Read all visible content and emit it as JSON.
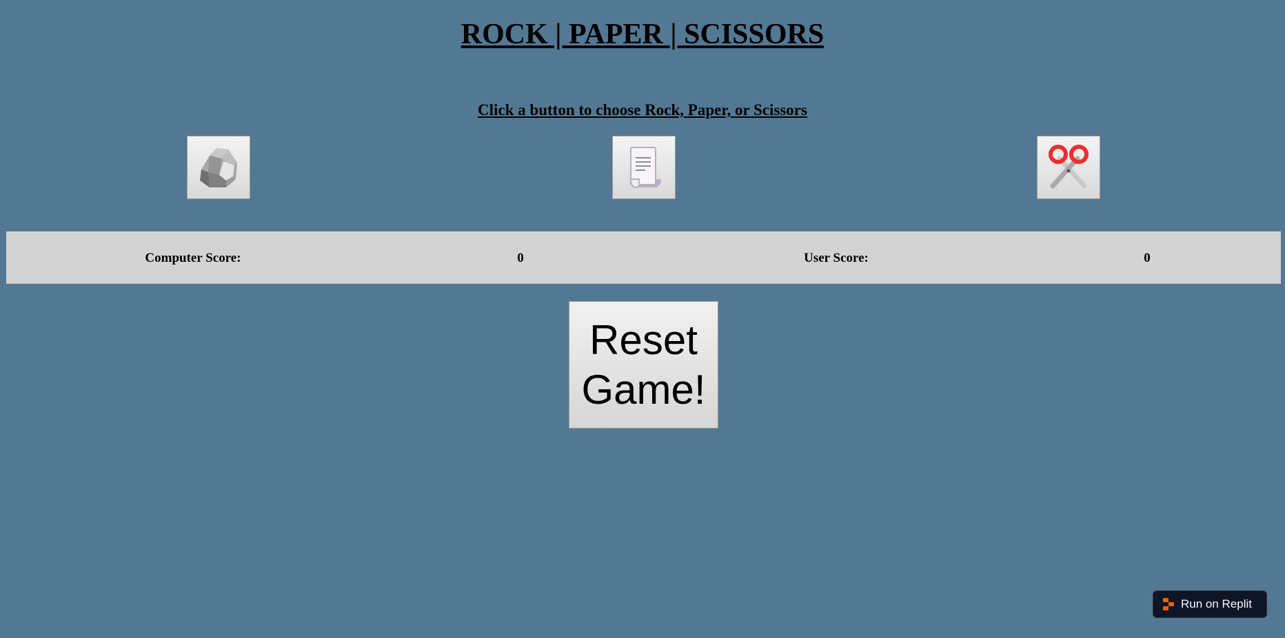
{
  "header": {
    "title": "ROCK | PAPER | SCISSORS"
  },
  "instructions": "Click a button to choose Rock, Paper, or Scissors",
  "choices": [
    {
      "name": "rock",
      "icon": "rock-icon"
    },
    {
      "name": "paper",
      "icon": "paper-icon"
    },
    {
      "name": "scissors",
      "icon": "scissors-icon"
    }
  ],
  "scoreboard": {
    "computer_label": "Computer Score:",
    "computer_score": "0",
    "user_label": "User Score:",
    "user_score": "0"
  },
  "reset": {
    "label": "Reset Game!"
  },
  "replit_badge": {
    "label": "Run on Replit",
    "icon": "replit-logo-icon",
    "accent": "#f26207"
  },
  "colors": {
    "background": "#537893",
    "scoreboard_bg": "#d3d3d3",
    "scissors_handle": "#ec2f2f"
  }
}
